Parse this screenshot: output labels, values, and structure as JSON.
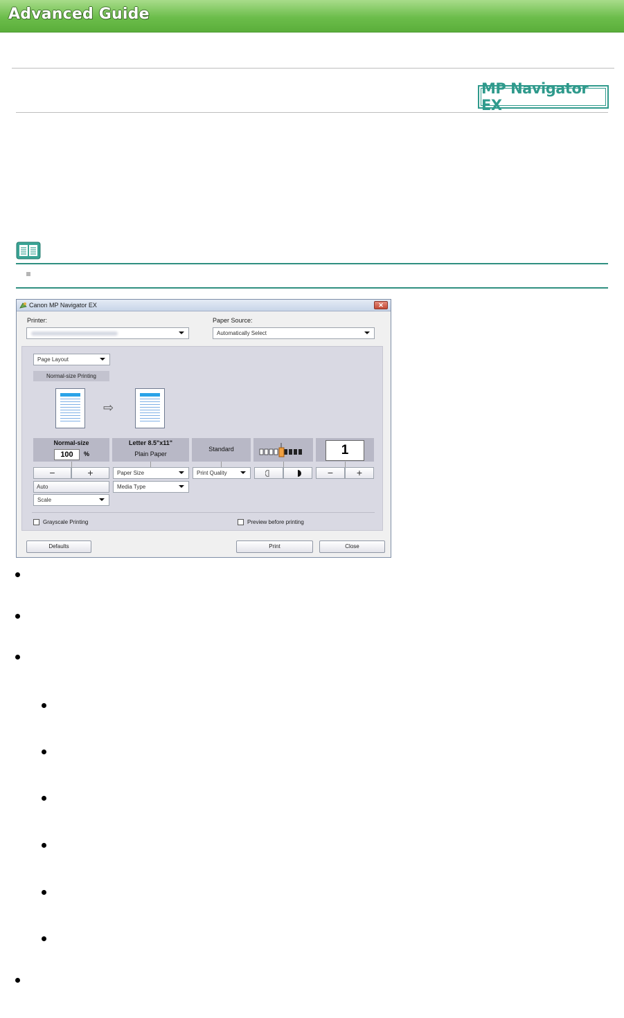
{
  "banner": {
    "title": "Advanced Guide"
  },
  "product_logo": "MP Navigator EX",
  "dialog": {
    "title": "Canon MP Navigator EX",
    "close_glyph": "✕",
    "printer_label": "Printer:",
    "paper_source_label": "Paper Source:",
    "paper_source_value": "Automatically Select",
    "page_layout_value": "Page Layout",
    "layout_option": "Normal-size Printing",
    "arrow_glyph": "⇨",
    "scale_title": "Normal-size",
    "scale_value": "100",
    "scale_unit": "%",
    "paper_title": "Letter 8.5\"x11\"",
    "paper_type": "Plain Paper",
    "quality": "Standard",
    "copies": "1",
    "minus": "−",
    "plus": "+",
    "auto_label": "Auto",
    "scale_select": "Scale",
    "paper_size_select": "Paper Size",
    "media_type_select": "Media Type",
    "print_quality_select": "Print Quality",
    "grayscale_label": "Grayscale Printing",
    "preview_label": "Preview before printing",
    "defaults_button": "Defaults",
    "print_button": "Print",
    "close_button": "Close"
  },
  "colors": {
    "banner": "#6cbd4b",
    "accent": "#2f9a8c",
    "note_rule": "#2f8f80"
  }
}
